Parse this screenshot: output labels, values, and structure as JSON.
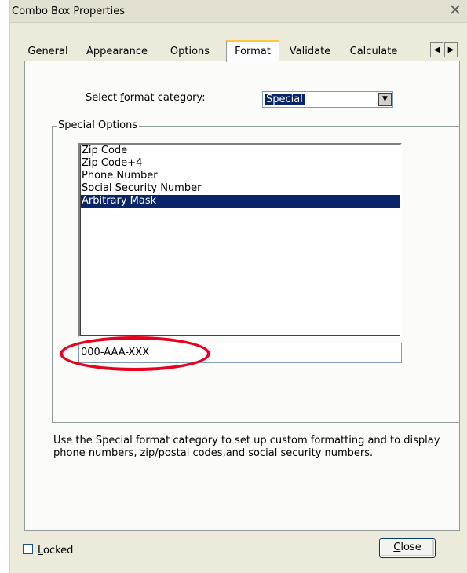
{
  "window": {
    "title": "Combo Box Properties",
    "close_glyph": "✕"
  },
  "tabs": [
    {
      "label": "General",
      "active": false
    },
    {
      "label": "Appearance",
      "active": false
    },
    {
      "label": "Options",
      "active": false
    },
    {
      "label": "Format",
      "active": true
    },
    {
      "label": "Validate",
      "active": false
    },
    {
      "label": "Calculate",
      "active": false
    }
  ],
  "tab_scroll": {
    "left_glyph": "◀",
    "right_glyph": "▶"
  },
  "format": {
    "label_pre": "Select ",
    "label_key": "f",
    "label_post": "ormat category:",
    "selected": "Special",
    "dropdown_glyph": "▼"
  },
  "special_options": {
    "legend": "Special Options",
    "items": [
      "Zip Code",
      "Zip Code+4",
      "Phone Number",
      "Social Security Number",
      "Arbitrary Mask"
    ],
    "selected_index": 4,
    "mask_value": "000-AAA-XXX"
  },
  "hint": "Use the Special format category to set up custom formatting and to display phone numbers, zip/postal codes,and social security numbers.",
  "locked": {
    "key": "L",
    "rest": "ocked",
    "checked": false
  },
  "close_button": {
    "key": "C",
    "rest": "lose"
  },
  "colors": {
    "selection": "#0a246a",
    "callout": "#e8001c",
    "active_tab_highlight": "#ffc83c"
  }
}
